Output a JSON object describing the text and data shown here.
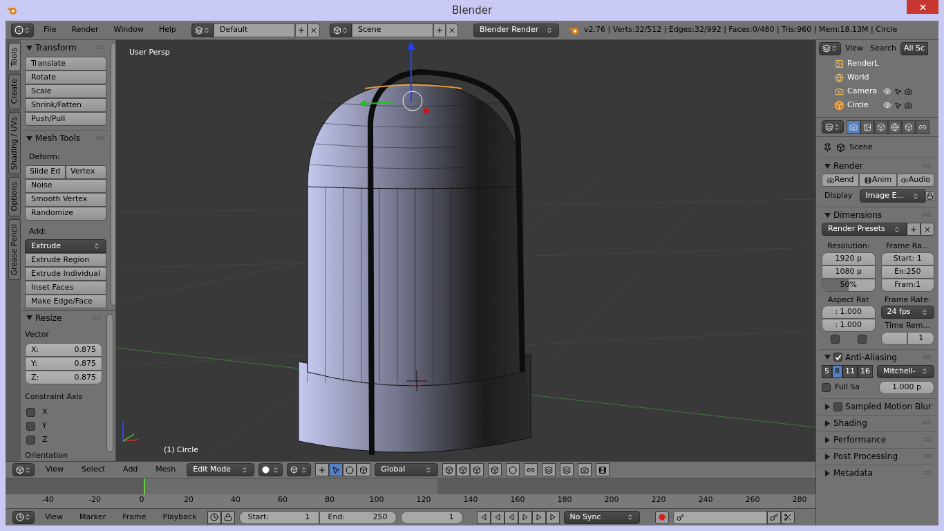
{
  "window": {
    "title": "Blender"
  },
  "info_header": {
    "menus": [
      "File",
      "Render",
      "Window",
      "Help"
    ],
    "layout": "Default",
    "scene": "Scene",
    "engine": "Blender Render",
    "stats": "v2.76 | Verts:32/512 | Edges:32/992 | Faces:0/480 | Tris:960 | Mem:18.13M | Circle"
  },
  "tool_tabs": [
    {
      "label": "Tools",
      "selected": true
    },
    {
      "label": "Create",
      "selected": false
    },
    {
      "label": "Shading / UVs",
      "selected": false
    },
    {
      "label": "Options",
      "selected": false
    },
    {
      "label": "Grease Pencil",
      "selected": false
    }
  ],
  "transform_panel": {
    "title": "Transform",
    "expanded": true,
    "buttons": [
      "Translate",
      "Rotate",
      "Scale",
      "Shrink/Fatten",
      "Push/Pull"
    ]
  },
  "mesh_tools_panel": {
    "title": "Mesh Tools",
    "expanded": true,
    "deform_label": "Deform:",
    "deform_row": [
      "Slide Ed",
      "Vertex"
    ],
    "deform_buttons": [
      "Noise",
      "Smooth Vertex",
      "Randomize"
    ],
    "add_label": "Add:",
    "add_dropdown": "Extrude",
    "add_buttons": [
      "Extrude Region",
      "Extrude Individual",
      "Inset Faces",
      "Make Edge/Face"
    ]
  },
  "operator_panel": {
    "title": "Resize",
    "expanded": true,
    "vector_label": "Vector",
    "fields": [
      {
        "label": "X:",
        "value": "0.875"
      },
      {
        "label": "Y:",
        "value": "0.875"
      },
      {
        "label": "Z:",
        "value": "0.875"
      }
    ],
    "constraint_label": "Constraint Axis",
    "axes": [
      {
        "label": "X",
        "checked": false
      },
      {
        "label": "Y",
        "checked": false
      },
      {
        "label": "Z",
        "checked": false
      }
    ],
    "orientation_label": "Orientation"
  },
  "viewport": {
    "view_label": "User Persp",
    "object_label": "(1) Circle"
  },
  "viewport_header": {
    "menus": [
      "View",
      "Select",
      "Add",
      "Mesh"
    ],
    "mode": "Edit Mode",
    "orientation": "Global"
  },
  "timeline": {
    "ruler_labels": [
      "-40",
      "-20",
      "0",
      "20",
      "40",
      "60",
      "80",
      "100",
      "120",
      "140",
      "160",
      "180",
      "200",
      "220",
      "240",
      "260",
      "280"
    ],
    "menus": [
      "View",
      "Marker",
      "Frame",
      "Playback"
    ],
    "start": {
      "label": "Start:",
      "value": "1"
    },
    "end": {
      "label": "End:",
      "value": "250"
    },
    "current": "1",
    "sync": "No Sync"
  },
  "outliner": {
    "menus": [
      "View",
      "Search"
    ],
    "filter": "All Sc",
    "items": [
      {
        "label": "RenderL",
        "selected": false
      },
      {
        "label": "World",
        "selected": false
      },
      {
        "label": "Camera",
        "selected": false
      },
      {
        "label": "Circle",
        "selected": true
      }
    ]
  },
  "property_tabs": [
    {
      "kind": "render",
      "selected": true
    },
    {
      "kind": "layers",
      "selected": false
    },
    {
      "kind": "scene",
      "selected": false
    },
    {
      "kind": "world",
      "selected": false
    },
    {
      "kind": "object",
      "selected": false
    },
    {
      "kind": "constraints",
      "selected": false
    }
  ],
  "properties": {
    "context": "Scene",
    "render_panel": {
      "title": "Render",
      "expanded": true,
      "buttons": [
        "Rend",
        "Anim",
        "Audio"
      ],
      "display_label": "Display",
      "display_value": "Image E..."
    },
    "dimensions_panel": {
      "title": "Dimensions",
      "expanded": true,
      "presets": "Render Presets",
      "resolution_label": "Resolution:",
      "resolution_fields": [
        "1920 p",
        "1080 p"
      ],
      "percentage": {
        "value": "50%",
        "level": 0.5
      },
      "frame_range_label": "Frame Ra...",
      "frame_fields": [
        "Start: 1",
        "En:250",
        "Fram:1"
      ],
      "aspect_label": "Aspect Rat",
      "aspect_fields": [
        ": 1.000",
        ": 1.000"
      ],
      "frame_rate_label": "Frame Rate:",
      "frame_rate": "24 fps",
      "time_remap_label": "Time Rem...",
      "time_remap_value": "1",
      "border_checks": [
        {
          "checked": false
        },
        {
          "checked": false
        }
      ]
    },
    "anti_aliasing_panel": {
      "title": "Anti-Aliasing",
      "expanded": true,
      "checked": true,
      "samples": [
        {
          "label": "5",
          "selected": false
        },
        {
          "label": "8",
          "selected": true
        },
        {
          "label": "11",
          "selected": false
        },
        {
          "label": "16",
          "selected": false
        }
      ],
      "filter": "Mitchell-",
      "full_sample": {
        "label": "Full Sa",
        "checked": false
      },
      "filter_size": "1.000 p"
    },
    "collapsed_panels": [
      {
        "title": "Sampled Motion Blur",
        "expanded": false,
        "kind": "checkbox",
        "checked": false
      },
      {
        "title": "Shading",
        "expanded": false,
        "kind": "plain"
      },
      {
        "title": "Performance",
        "expanded": false,
        "kind": "plain"
      },
      {
        "title": "Post Processing",
        "expanded": false,
        "kind": "plain"
      },
      {
        "title": "Metadata",
        "expanded": false,
        "kind": "plain"
      }
    ]
  }
}
